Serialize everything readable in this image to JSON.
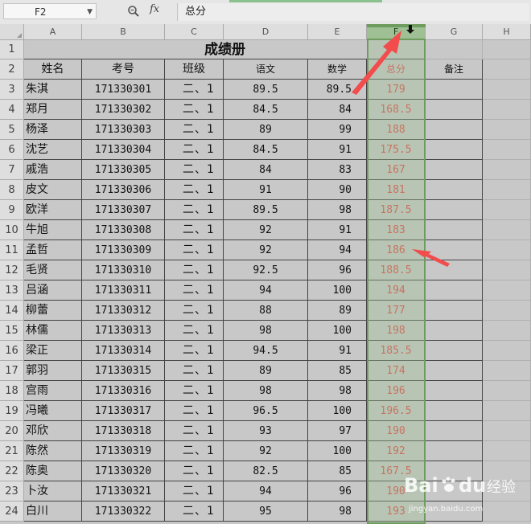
{
  "formula_bar": {
    "cell_ref": "F2",
    "formula_value": "总分",
    "fx_label": "fx"
  },
  "columns": [
    "A",
    "B",
    "C",
    "D",
    "E",
    "F",
    "G",
    "H"
  ],
  "selected_column": "F",
  "title": "成绩册",
  "headers": [
    "姓名",
    "考号",
    "班级",
    "语文",
    "数学",
    "总分",
    "备注"
  ],
  "rows": [
    {
      "row": 3,
      "name": "朱淇",
      "id": "171330301",
      "cls": "二、1",
      "chinese": "89.5",
      "math": "89.5",
      "total": "179"
    },
    {
      "row": 4,
      "name": "郑月",
      "id": "171330302",
      "cls": "二、1",
      "chinese": "84.5",
      "math": "84",
      "total": "168.5"
    },
    {
      "row": 5,
      "name": "杨泽",
      "id": "171330303",
      "cls": "二、1",
      "chinese": "89",
      "math": "99",
      "total": "188"
    },
    {
      "row": 6,
      "name": "沈艺",
      "id": "171330304",
      "cls": "二、1",
      "chinese": "84.5",
      "math": "91",
      "total": "175.5"
    },
    {
      "row": 7,
      "name": "戚浩",
      "id": "171330305",
      "cls": "二、1",
      "chinese": "84",
      "math": "83",
      "total": "167"
    },
    {
      "row": 8,
      "name": "皮文",
      "id": "171330306",
      "cls": "二、1",
      "chinese": "91",
      "math": "90",
      "total": "181"
    },
    {
      "row": 9,
      "name": "欧洋",
      "id": "171330307",
      "cls": "二、1",
      "chinese": "89.5",
      "math": "98",
      "total": "187.5"
    },
    {
      "row": 10,
      "name": "牛旭",
      "id": "171330308",
      "cls": "二、1",
      "chinese": "92",
      "math": "91",
      "total": "183"
    },
    {
      "row": 11,
      "name": "孟哲",
      "id": "171330309",
      "cls": "二、1",
      "chinese": "92",
      "math": "94",
      "total": "186"
    },
    {
      "row": 12,
      "name": "毛贤",
      "id": "171330310",
      "cls": "二、1",
      "chinese": "92.5",
      "math": "96",
      "total": "188.5"
    },
    {
      "row": 13,
      "name": "吕涵",
      "id": "171330311",
      "cls": "二、1",
      "chinese": "94",
      "math": "100",
      "total": "194"
    },
    {
      "row": 14,
      "name": "柳蕾",
      "id": "171330312",
      "cls": "二、1",
      "chinese": "88",
      "math": "89",
      "total": "177"
    },
    {
      "row": 15,
      "name": "林儒",
      "id": "171330313",
      "cls": "二、1",
      "chinese": "98",
      "math": "100",
      "total": "198"
    },
    {
      "row": 16,
      "name": "梁正",
      "id": "171330314",
      "cls": "二、1",
      "chinese": "94.5",
      "math": "91",
      "total": "185.5"
    },
    {
      "row": 17,
      "name": "郭羽",
      "id": "171330315",
      "cls": "二、1",
      "chinese": "89",
      "math": "85",
      "total": "174"
    },
    {
      "row": 18,
      "name": "宫雨",
      "id": "171330316",
      "cls": "二、1",
      "chinese": "98",
      "math": "98",
      "total": "196"
    },
    {
      "row": 19,
      "name": "冯曦",
      "id": "171330317",
      "cls": "二、1",
      "chinese": "96.5",
      "math": "100",
      "total": "196.5"
    },
    {
      "row": 20,
      "name": "邓欣",
      "id": "171330318",
      "cls": "二、1",
      "chinese": "93",
      "math": "97",
      "total": "190"
    },
    {
      "row": 21,
      "name": "陈然",
      "id": "171330319",
      "cls": "二、1",
      "chinese": "92",
      "math": "100",
      "total": "192"
    },
    {
      "row": 22,
      "name": "陈奥",
      "id": "171330320",
      "cls": "二、1",
      "chinese": "82.5",
      "math": "85",
      "total": "167.5"
    },
    {
      "row": 23,
      "name": "卜汝",
      "id": "171330321",
      "cls": "二、1",
      "chinese": "94",
      "math": "96",
      "total": "190"
    },
    {
      "row": 24,
      "name": "白川",
      "id": "171330322",
      "cls": "二、1",
      "chinese": "95",
      "math": "98",
      "total": "193"
    }
  ],
  "colors": {
    "total_text": "#e24444",
    "selection": "#6e9b5e",
    "arrow": "#f24c4c"
  },
  "watermark": {
    "brand": "Bai",
    "brand2": "du",
    "suffix": "经验",
    "url": "jingyan.baidu.com"
  }
}
